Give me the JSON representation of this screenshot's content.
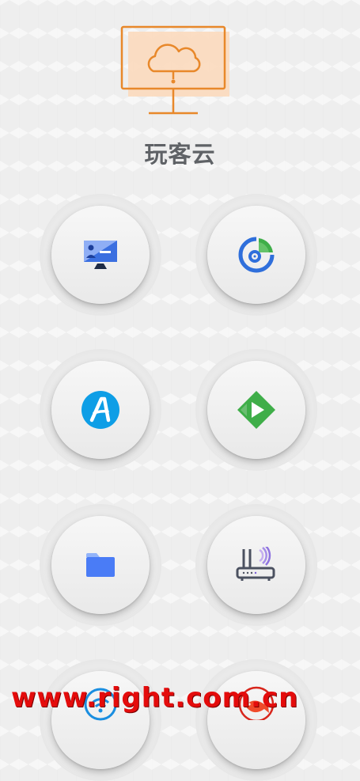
{
  "app": {
    "title": "玩客云"
  },
  "colors": {
    "logo": "#e8882a",
    "blue": "#2f6fdb",
    "green": "#3fae49",
    "cyan": "#0e9ee6",
    "watermark": "#e40c0c"
  },
  "logo": {
    "icon": "cloud-monitor-icon"
  },
  "tiles": [
    {
      "icon": "remote-desktop-icon"
    },
    {
      "icon": "disk-usage-icon"
    },
    {
      "icon": "aria2-download-icon"
    },
    {
      "icon": "emby-media-icon"
    },
    {
      "icon": "folder-icon"
    },
    {
      "icon": "router-icon"
    },
    {
      "icon": "wifi-icon"
    },
    {
      "icon": "fish-icon"
    }
  ],
  "watermark": {
    "text": "www.right.com.cn"
  }
}
